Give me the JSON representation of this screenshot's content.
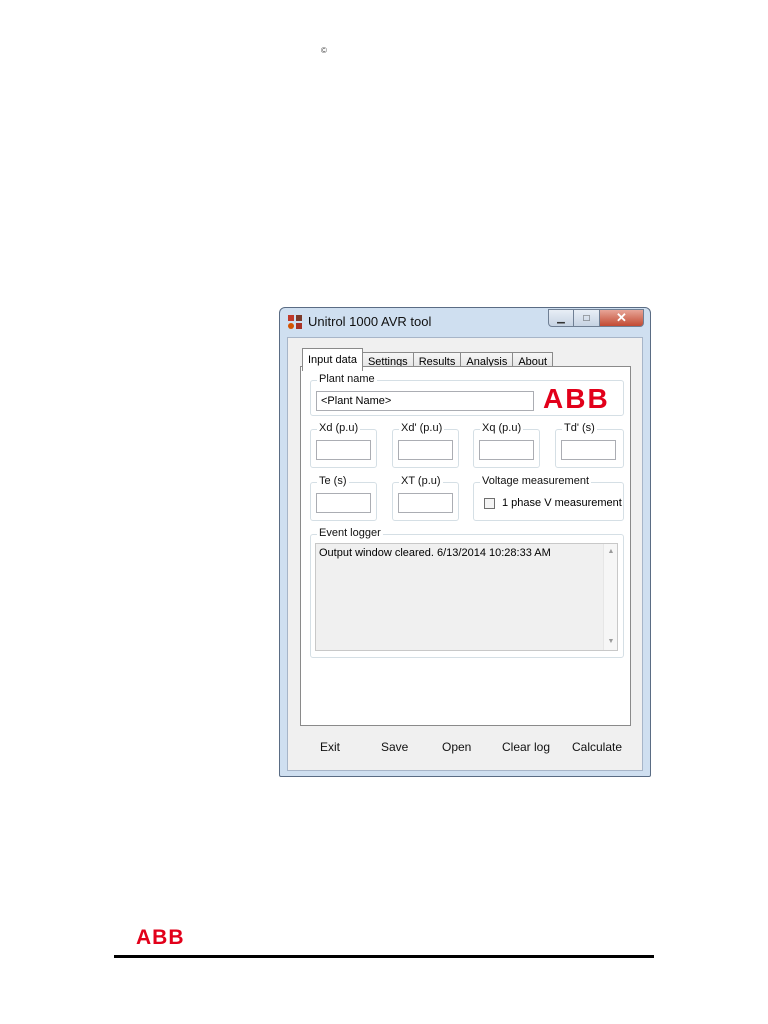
{
  "page": {
    "copyright_mark": "©"
  },
  "window": {
    "title": "Unitrol 1000 AVR tool",
    "min_label": "▁",
    "max_label": "□",
    "close_label": "✕"
  },
  "tabs": [
    {
      "label": "Input data",
      "active": true
    },
    {
      "label": "Settings"
    },
    {
      "label": "Results"
    },
    {
      "label": "Analysis"
    },
    {
      "label": "About"
    }
  ],
  "input_data": {
    "plant_name": {
      "label": "Plant name",
      "value": "<Plant Name>"
    },
    "logo_text": "ABB",
    "fields": [
      {
        "label": "Xd (p.u)",
        "value": ""
      },
      {
        "label": "Xd' (p.u)",
        "value": ""
      },
      {
        "label": "Xq (p.u)",
        "value": ""
      },
      {
        "label": "Td' (s)",
        "value": ""
      },
      {
        "label": "Te (s)",
        "value": ""
      },
      {
        "label": "XT (p.u)",
        "value": ""
      }
    ],
    "voltage_measurement": {
      "label": "Voltage measurement",
      "checkbox_label": "1 phase V measurement",
      "checked": false
    },
    "event_logger": {
      "label": "Event logger",
      "text": "Output window cleared. 6/13/2014 10:28:33 AM"
    }
  },
  "buttons": {
    "exit": "Exit",
    "save": "Save",
    "open": "Open",
    "clear_log": "Clear log",
    "calculate": "Calculate"
  },
  "footer": {
    "logo_text": "ABB"
  },
  "colors": {
    "brand_red": "#e2001a",
    "window_frame": "#cfdff0"
  }
}
